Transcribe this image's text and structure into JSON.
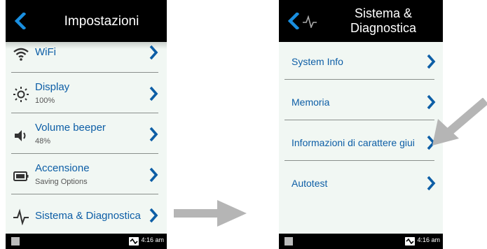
{
  "left_screen": {
    "header_title": "Impostazioni",
    "rows": [
      {
        "label": "WiFi",
        "sub": "",
        "icon": "wifi-icon"
      },
      {
        "label": "Display",
        "sub": "100%",
        "icon": "brightness-icon"
      },
      {
        "label": "Volume beeper",
        "sub": "48%",
        "icon": "speaker-icon"
      },
      {
        "label": "Accensione",
        "sub": "Saving Options",
        "icon": "battery-icon"
      },
      {
        "label": "Sistema & Diagnostica",
        "sub": "",
        "icon": "pulse-icon"
      }
    ],
    "status_time": "4:16 am"
  },
  "right_screen": {
    "header_title_line1": "Sistema &",
    "header_title_line2": "Diagnostica",
    "rows": [
      {
        "label": "System Info"
      },
      {
        "label": "Memoria"
      },
      {
        "label": "Informazioni di carattere giui"
      },
      {
        "label": "Autotest"
      }
    ],
    "status_time": "4:16 am"
  },
  "colors": {
    "accent": "#0d5ea6",
    "screen_bg": "#f1f7f3",
    "bar": "#000000",
    "arrow": "#b5b5b5"
  }
}
